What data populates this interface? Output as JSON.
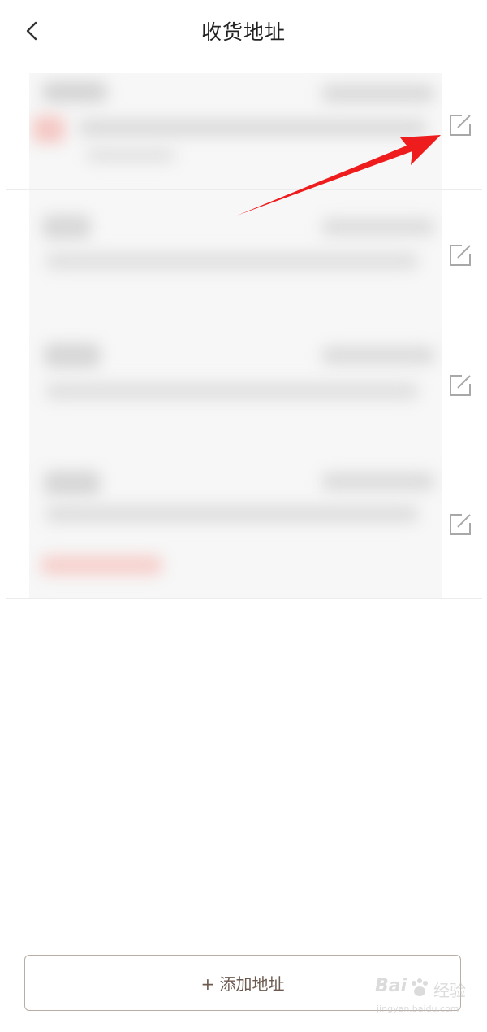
{
  "header": {
    "title": "收货地址"
  },
  "addresses": [
    {
      "index": 1
    },
    {
      "index": 2
    },
    {
      "index": 3
    },
    {
      "index": 4
    }
  ],
  "footer": {
    "add_label": "+ 添加地址"
  },
  "watermark": {
    "brand": "Bai",
    "suffix": "经验",
    "url": "jingyan.baidu.com"
  },
  "colors": {
    "annotation_arrow": "#ee1c1c",
    "add_button_text": "#6d5a4f",
    "add_button_border": "#b9aea6",
    "divider": "#ececec"
  }
}
